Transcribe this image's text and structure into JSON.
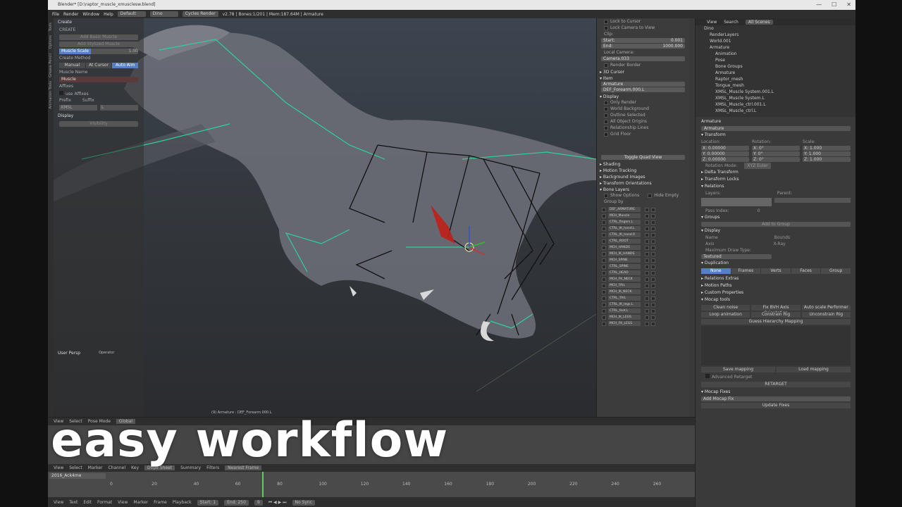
{
  "window": {
    "title": "Blender* [D:\\raptor_muscle_xmusclesw.blend]",
    "controls": [
      "—",
      "☐",
      "✕"
    ]
  },
  "infobar": {
    "menus": [
      "File",
      "Render",
      "Window",
      "Help"
    ],
    "layout": "Default",
    "scene": "Dino",
    "engine": "Cycles Render",
    "stats": "v2.78 | Bones:1/201 | Mem:187.64M | Armature"
  },
  "left_tabs": [
    "Tools",
    "Options",
    "Grease Pencil",
    "Animation Tools"
  ],
  "toolshelf": {
    "header": "Create",
    "label_create": "CREATE",
    "add_basic_muscle": "Add Basic Muscle",
    "add_stylized_muscle": "Add Stylized Muscle",
    "muscle_value_label": "Muscle Scale",
    "muscle_value": "1.00",
    "create_method": "Create Method",
    "methods": [
      "Manual",
      "At Cursor",
      "Auto Aim"
    ],
    "active_method": "Auto Aim",
    "muscle_name_label": "Muscle Name",
    "muscle_name": "Muscle",
    "affixes_label": "Affixes",
    "use_affixes": "use Affixes",
    "prefix_label": "Prefix",
    "suffix_label": "Suffix",
    "prefix_value": "XMSL",
    "suffix_value": "L",
    "display_label": "Display",
    "visibility_label": "Visibility"
  },
  "viewport": {
    "hud_label": "User Persp",
    "status": "(9) Armature : DEF_Forearm.000.L",
    "operator": "Operator"
  },
  "npanel": {
    "lock_to_cursor": "Lock to Cursor",
    "lock_camera": "Lock Camera to View",
    "clip": "Clip:",
    "start_label": "Start:",
    "start_value": "0.001",
    "end_label": "End:",
    "end_value": "1000.000",
    "local_camera": "Local Camera:",
    "camera_value": "Camera.033",
    "render_border": "Render Border",
    "cursor_3d": "3D Cursor",
    "item": "Item",
    "item_name": "Armature",
    "bone_name": "DEF_Forearm.000.L",
    "display": "Display",
    "only_render": "Only Render",
    "world_background": "World Background",
    "outline_selected": "Outline Selected",
    "all_object_origins": "All Object Origins",
    "relationship_lines": "Relationship Lines",
    "grid_floor": "Grid Floor",
    "toggle_quad_view": "Toggle Quad View",
    "shading": "Shading",
    "motion_tracking": "Motion Tracking",
    "background_images": "Background Images",
    "transform_orientations": "Transform Orientations",
    "bone_layers": "Bone Layers",
    "show_options": "Show Options",
    "hide_empty": "Hide Empty",
    "group_by": "Group by",
    "layers": [
      "DEF_ARMATURE",
      "MCH_Muscle",
      "CTRL_fingers.L",
      "CTRL_IK_hand.L",
      "CTRL_IK_hand.R",
      "CTRL_ROOT",
      "MCH_HANDS",
      "MCH_IK_HANDS",
      "MCH_SPINE",
      "CTRL_SPINE",
      "CTRL_HEAD",
      "MCH_FK_NECK",
      "MCH_TAIL",
      "MCH_IK_NECK",
      "CTRL_TAIL",
      "CTRL_IK_legs.L",
      "CTRL_foot.L",
      "MCH_IK_LEGS",
      "MCH_FK_LEGS"
    ]
  },
  "outliner": {
    "menus": [
      "View",
      "Search"
    ],
    "filter": "All Scenes",
    "rows": [
      "Dino",
      "RenderLayers",
      "World.001",
      "Armature",
      "Animation",
      "Pose",
      "Bone Groups",
      "Armature",
      "Raptor_mesh",
      "Tongue_mesh",
      "XMSL_Muscle System.001.L",
      "XMSL_Muscle System.L",
      "XMSL_Muscle_ctrl.001.L",
      "XMSL_Muscle_ctrl.L"
    ]
  },
  "properties": {
    "object_name": "Armature",
    "name_field": "Armature",
    "transform": "Transform",
    "location": "Location:",
    "rotation": "Rotation:",
    "scale": "Scale:",
    "loc_values": [
      "X: 0.00000",
      "Y: 0.00000",
      "Z: 0.00000"
    ],
    "rot_values": [
      "X: 0°",
      "Y: 0°",
      "Z: 0°"
    ],
    "scale_values": [
      "X: 1.000",
      "Y: 1.000",
      "Z: 1.000"
    ],
    "rotation_mode_label": "Rotation Mode:",
    "rotation_mode": "XYZ Euler",
    "delta_transform": "Delta Transform",
    "transform_locks": "Transform Locks",
    "relations": "Relations",
    "layers_label": "Layers:",
    "parent_label": "Parent:",
    "pass_index": "Pass Index:",
    "pass_value": "0",
    "groups": "Groups",
    "add_to_group": "Add to Group",
    "display": "Display",
    "name_chk": "Name",
    "axis_chk": "Axis",
    "bounds_chk": "Bounds",
    "xray_chk": "X-Ray",
    "max_draw_type": "Maximum Draw Type:",
    "draw_type": "Textured",
    "duplication": "Duplication",
    "dup_tabs": [
      "None",
      "Frames",
      "Verts",
      "Faces",
      "Group"
    ],
    "relations_extras": "Relations Extras",
    "motion_paths": "Motion Paths",
    "custom_properties": "Custom Properties",
    "mocap_tools": "Mocap tools",
    "mocap_btns_1": [
      "Clean noise",
      "Fix BVH Axis Orientation",
      "Auto scale Performer"
    ],
    "mocap_btns_2": [
      "Loop animation",
      "Constrain Rig",
      "Unconstrain Rig"
    ],
    "guess_mapping": "Guess Hierarchy Mapping",
    "save_mapping": "Save mapping",
    "load_mapping": "Load mapping",
    "advanced_retarget": "Advanced Retarget",
    "retarget": "RETARGET",
    "mocap_fixes": "Mocap Fixes",
    "add_mocap_fix": "Add Mocap Fix",
    "update_fixes": "Update Fixes"
  },
  "timeline": {
    "view_menus": [
      "View",
      "Select",
      "Pose Mode"
    ],
    "orientation": "Global",
    "dope_menus": [
      "View",
      "Select",
      "Marker",
      "Channel",
      "Key"
    ],
    "mode": "Dope Sheet",
    "summary": "Summary",
    "filters": "Filters",
    "nearest_frame": "Nearest Frame",
    "channel_label": "2016_Ack4me",
    "bottom_menus": [
      "View",
      "Text",
      "Edit",
      "Format",
      "View",
      "Marker",
      "Frame",
      "Playback"
    ],
    "start_label": "Start:",
    "start": "1",
    "end_label": "End:",
    "end": "250",
    "current": "9",
    "sync": "No Sync",
    "ruler": [
      "0",
      "20",
      "40",
      "60",
      "80",
      "100",
      "120",
      "140",
      "160",
      "180",
      "200",
      "220",
      "240",
      "260"
    ],
    "current_frame_fraction": 0.52
  },
  "caption": "easy workflow",
  "colors": {
    "bone_active": "#2fd09a",
    "bone_dark": "#111111",
    "accent": "#5680c2"
  }
}
